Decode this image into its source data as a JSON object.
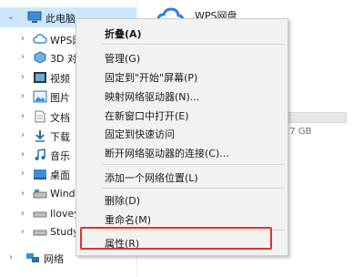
{
  "nav": {
    "items": [
      {
        "label": "此电脑",
        "icon": "computer-icon"
      },
      {
        "label": "WPS网",
        "icon": "cloud-icon"
      },
      {
        "label": "3D 对",
        "icon": "cube-icon"
      },
      {
        "label": "视频",
        "icon": "video-icon"
      },
      {
        "label": "图片",
        "icon": "picture-icon"
      },
      {
        "label": "文档",
        "icon": "document-icon"
      },
      {
        "label": "下载",
        "icon": "download-icon"
      },
      {
        "label": "音乐",
        "icon": "music-icon"
      },
      {
        "label": "桌面",
        "icon": "desktop-icon"
      },
      {
        "label": "Windo",
        "icon": "drive-icon"
      },
      {
        "label": "Ilovey",
        "icon": "drive-icon"
      },
      {
        "label": "Study",
        "icon": "drive-icon"
      },
      {
        "label": "网络",
        "icon": "network-icon"
      }
    ]
  },
  "content": {
    "wps_title": "WPS网盘",
    "capacity_text": "27 GB"
  },
  "menu": {
    "items": [
      {
        "label": "折叠(A)",
        "bold": true
      },
      {
        "label": "管理(G)"
      },
      {
        "label": "固定到\"开始\"屏幕(P)"
      },
      {
        "label": "映射网络驱动器(N)..."
      },
      {
        "label": "在新窗口中打开(E)"
      },
      {
        "label": "固定到快速访问"
      },
      {
        "label": "断开网络驱动器的连接(C)..."
      },
      {
        "label": "添加一个网络位置(L)"
      },
      {
        "label": "删除(D)"
      },
      {
        "label": "重命名(M)"
      },
      {
        "label": "属性(R)"
      }
    ]
  },
  "colors": {
    "highlight": "#e0322e",
    "selection": "#cce8ff"
  }
}
